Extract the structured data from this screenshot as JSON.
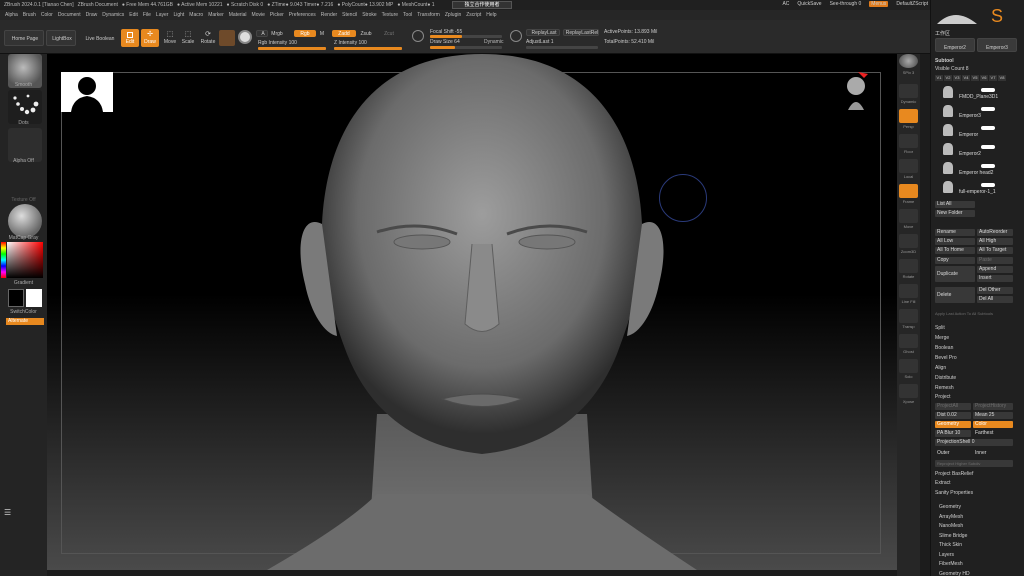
{
  "app": {
    "title": "ZBrush 2024.0.1 [Tianao Chen]",
    "document": "ZBrush Document",
    "free_mem": "● Free Mem 44.761GB",
    "active_mem": "● Active Mem 10221",
    "scratch": "● Scratch Disk 0",
    "ztime": "● ZTime● 9.043 Timer● 7.216",
    "polycount": "● PolyCount● 13.902 MP",
    "meshcount": "● MeshCount● 1",
    "chinese_tab": "独立合作使用者",
    "ac": "AC",
    "quicksave": "QuickSave",
    "seethrough": "See-through 0",
    "menus": "Menus",
    "defaultscript": "DefaultZScript"
  },
  "menus": [
    "Alpha",
    "Brush",
    "Color",
    "Document",
    "Draw",
    "Dynamics",
    "Edit",
    "File",
    "Layer",
    "Light",
    "Macro",
    "Marker",
    "Material",
    "Movie",
    "Picker",
    "Preferences",
    "Render",
    "Stencil",
    "Stroke",
    "Texture",
    "Tool",
    "Transform",
    "Zplugin",
    "Zscript",
    "Help"
  ],
  "toolbar": {
    "home": "Home Page",
    "lightbox": "LightBox",
    "live_boolean": "Live Boolean",
    "edit": "Edit",
    "draw": "Draw",
    "move": "Move",
    "scale": "Scale",
    "rotate": "Rotate",
    "a": "A",
    "mrgb": "Mrgb",
    "rgb": "Rgb",
    "m": "M",
    "zadd": "Zadd",
    "zsub": "Zsub",
    "zcut": "Zcut",
    "rgb_intensity": "Rgb Intensity 100",
    "z_intensity": "Z Intensity 100",
    "focal_shift": "Focal Shift -55",
    "draw_size": "Draw Size 64",
    "dynamic": "Dynamic",
    "replay_last": "ReplayLast",
    "replay_last_rel": "ReplayLastRel",
    "adjust_last": "AdjustLast 1",
    "active_points": "ActivePoints: 13.893 Mil",
    "total_points": "TotalPoints: 52.410 Mil",
    "rgb_intensity_val": 1.0,
    "z_intensity_val": 1.0,
    "focal_val": 0.45,
    "draw_size_val": 0.35
  },
  "left_shelf": {
    "brush": "Smooth",
    "stroke": "Dots",
    "alpha": "Alpha Off",
    "texture": "Texture Off",
    "material": "MatCap Gray",
    "gradient": "Gradient",
    "switch_color": "SwitchColor",
    "alternate": "Alternate"
  },
  "right_shelf": {
    "spix": "SPix 3",
    "items": [
      "Dynamic",
      "Persp",
      "Floor",
      "Local",
      "Frame",
      "Move",
      "Zoom3D",
      "Rotate",
      "Line Fill",
      "Transp",
      "Ghost",
      "Solo",
      "Xpose"
    ],
    "bpr": "BPR"
  },
  "panel": {
    "subtool": "Subtool",
    "visible_count": "Visible Count 8",
    "vtabs": [
      "V1",
      "V2",
      "V3",
      "V4",
      "V5",
      "V6",
      "V7",
      "V8"
    ],
    "tool_names": [
      "Emperor2",
      "Emperor3"
    ],
    "subtools": [
      "FMDD_Plane3D1",
      "Emperor3",
      "Emperor",
      "Emperor2",
      "Emperor head2",
      "full-emperor-1_1"
    ],
    "list_all": "List All",
    "new_folder": "New Folder",
    "rename": "Rename",
    "autoreorder": "AutoReorder",
    "all_low": "All Low",
    "all_high": "All High",
    "all_to_home": "All To Home",
    "all_to_target": "All To Target",
    "copy": "Copy",
    "paste": "Paste",
    "duplicate": "Duplicate",
    "append": "Append",
    "insert": "Insert",
    "delete": "Delete",
    "del_other": "Del Other",
    "del_all": "Del All",
    "apply_last": "Apply Last Action To All Subtools",
    "actions": [
      "Split",
      "Merge",
      "Boolean",
      "Bevel Pro",
      "Align",
      "Distribute",
      "Remesh"
    ],
    "project": "Project",
    "project_all": "ProjectAll",
    "project_history": "ProjectHistory",
    "dist": "Dist 0.02",
    "mean": "Mean 25",
    "geometry": "Geometry",
    "color": "Color",
    "pa_blur": "PA Blur 10",
    "farthest": "Farthest",
    "projection_shell": "ProjectionShell 0",
    "outer": "Outer",
    "inner": "Inner",
    "reproject": "Reproject Higher Subdiv",
    "project_bas": "Project BasRelief",
    "extract": "Extract",
    "subtool_master": "Sanity Properties",
    "sections": [
      "Geometry",
      "ArrayMesh",
      "NanoMesh",
      "Slime Bridge",
      "Thick Skin",
      "Layers",
      "FiberMesh",
      "Geometry HD"
    ]
  }
}
